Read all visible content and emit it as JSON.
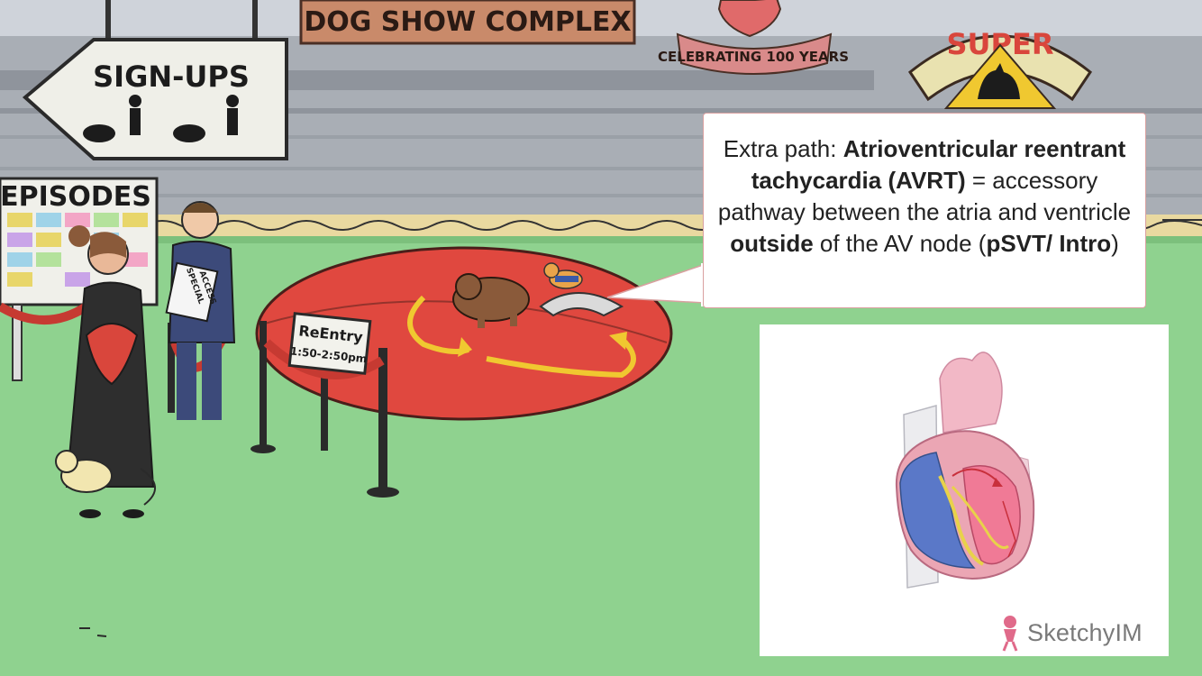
{
  "scene": {
    "banner_top": "DOG SHOW COMPLEX",
    "banner_celebrate": "CELEBRATING 100 YEARS",
    "banner_super": "SUPER",
    "sign_signups": "SIGN-UPS",
    "board_title": "EPISODES",
    "badge_text_1": "SPECIAL",
    "badge_text_2": "ACCESS",
    "sign_reentry_1": "ReEntry",
    "sign_reentry_2": "1:50-2:50pm"
  },
  "callout": {
    "t1": "Extra path: ",
    "b1": "Atrioventricular reentrant tachycardia (AVRT)",
    "t2": " = accessory pathway between the atria and ventricle ",
    "b2": "outside",
    "t3": " of the AV node (",
    "b3": "pSVT/ Intro",
    "t4": ")"
  },
  "brand": {
    "name": "SketchyIM"
  },
  "colors": {
    "grass": "#8fd28f",
    "wall": "#a8adb4",
    "red_rug": "#e0483f",
    "accent": "#e06a8a"
  }
}
